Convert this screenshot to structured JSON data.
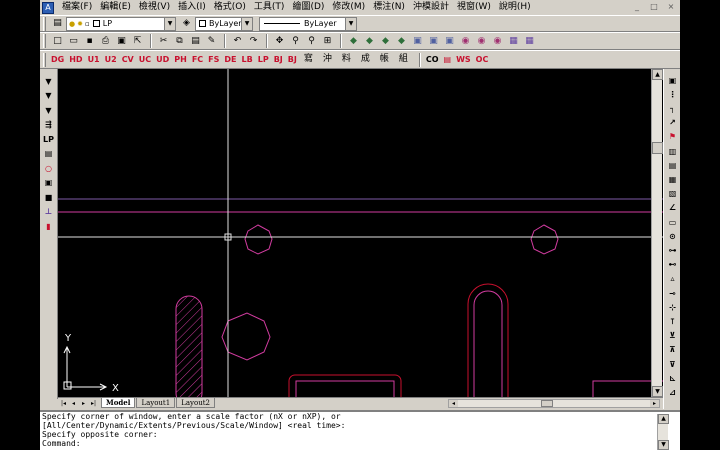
{
  "menu": {
    "items": [
      "檔案(F)",
      "編輯(E)",
      "檢視(V)",
      "插入(I)",
      "格式(O)",
      "工具(T)",
      "繪圖(D)",
      "修改(M)",
      "標注(N)",
      "沖模設計",
      "視窗(W)",
      "說明(H)"
    ]
  },
  "window_controls": [
    "_",
    "□",
    "×"
  ],
  "layer_toolbar": {
    "layer_value": "LP",
    "color_value": "ByLayer",
    "linetype_value": "ByLayer"
  },
  "standard_toolbar": {
    "icons": [
      "new-icon",
      "open-icon",
      "save-icon",
      "print-icon",
      "preview-icon",
      "publish-icon",
      "cut-icon",
      "copy-icon",
      "paste-icon",
      "match-prop-icon",
      "undo-icon",
      "redo-icon",
      "pan-icon",
      "zoom-realtime-icon",
      "zoom-window-icon",
      "properties-icon"
    ],
    "glyphs": [
      "□",
      "▭",
      "▪",
      "⎙",
      "▣",
      "⇱",
      "✂",
      "⧉",
      "▤",
      "✎",
      "↶",
      "↷",
      "✥",
      "⚲",
      "⚲",
      "⊞"
    ]
  },
  "die_toolbar": {
    "labels": [
      "DG",
      "HD",
      "U1",
      "U2",
      "CV",
      "UC",
      "UD",
      "PH",
      "FC",
      "FS",
      "DE",
      "LB",
      "LP",
      "BJ",
      "BJ"
    ],
    "cjk_labels": [
      "寫",
      "沖",
      "料",
      "成",
      "帳",
      "組"
    ],
    "extra_labels": [
      "CO",
      "▤",
      "WS",
      "OC"
    ]
  },
  "drawing": {
    "ucs_x_label": "X",
    "ucs_y_label": "Y",
    "colors": {
      "background": "#000000",
      "magenta": "#d23ca0",
      "red": "#c8102e",
      "crosshair": "#e0e0e0"
    }
  },
  "left_tools": [
    "▼",
    "▼",
    "▼",
    "⇶",
    "LP",
    "▤",
    "○",
    "▣",
    "■",
    "⊥",
    "▮"
  ],
  "right_tools": [
    "▣",
    "⋮",
    "┐",
    "↗",
    "⚑",
    "▥",
    "▤",
    "▦",
    "▧",
    "∠",
    "▭",
    "⊙",
    "⊶",
    "⊷",
    "▵",
    "⊸",
    "⊹",
    "⊺",
    "⊻",
    "⊼",
    "⊽",
    "⊾",
    "⊿"
  ],
  "tabs": {
    "nav": [
      "|◂",
      "◂",
      "▸",
      "▸|"
    ],
    "items": [
      "Model",
      "Layout1",
      "Layout2"
    ]
  },
  "command": {
    "lines": [
      "Specify corner of window, enter a scale factor (nX or nXP), or",
      "[All/Center/Dynamic/Extents/Previous/Scale/Window] <real time>:",
      "Specify opposite corner:",
      "Command:"
    ]
  }
}
